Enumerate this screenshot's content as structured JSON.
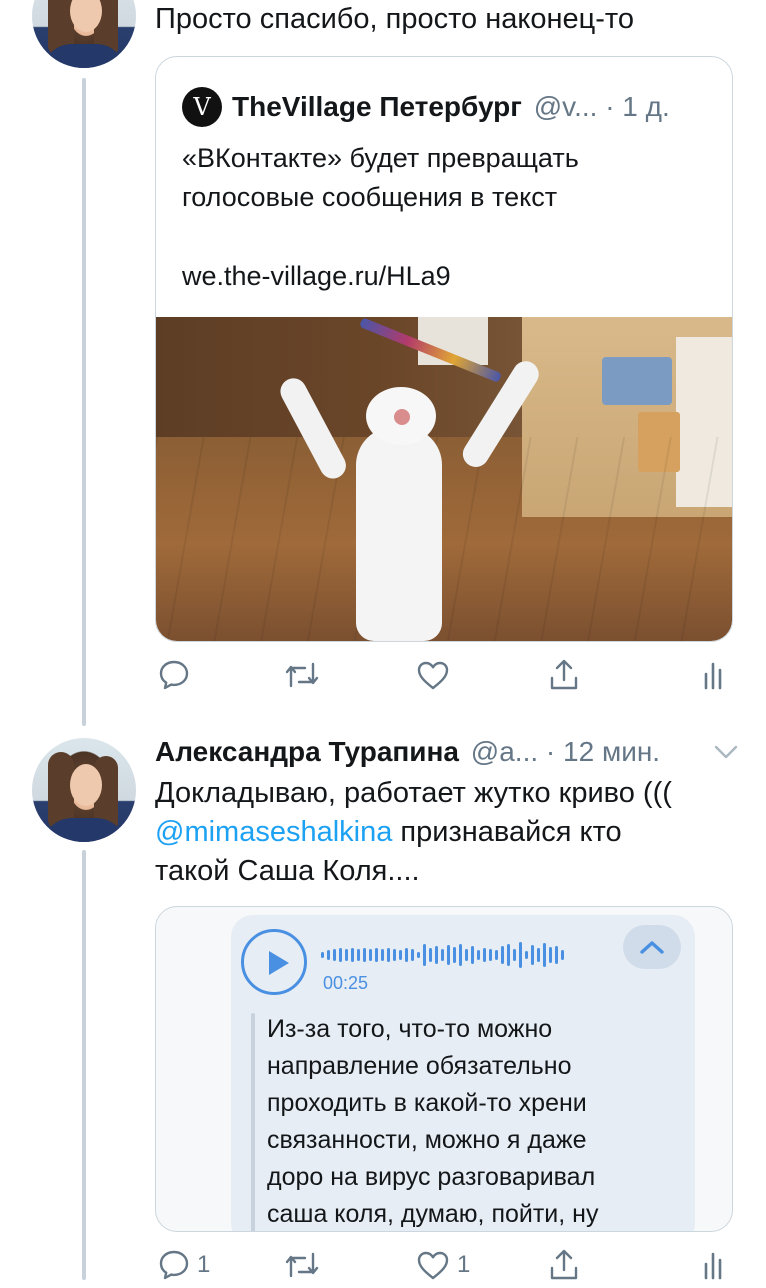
{
  "tweet1": {
    "text": "Просто спасибо, просто наконец-то",
    "quote": {
      "author_name": "TheVillage Петербург",
      "handle": "@v...",
      "separator": "·",
      "time": "1 д.",
      "logo_letter": "V",
      "text_line1": "«ВКонтакте» будет превращать",
      "text_line2": "голосовые сообщения в текст",
      "link": "we.the-village.ru/HLa9"
    },
    "actions": {
      "reply_count": "",
      "retweet_count": "",
      "like_count": ""
    }
  },
  "tweet2": {
    "author_name": "Александра Турапина",
    "handle": "@a...",
    "separator": "·",
    "time": "12 мин.",
    "text_line1": "Докладываю, работает жутко криво (((",
    "mention": "@mimaseshalkina",
    "text_line2_rest": " признавайся кто",
    "text_line3": "такой Саша Коля....",
    "voice": {
      "duration": "00:25",
      "transcript": [
        "Из-за того, что-то можно",
        "направление обязательно",
        "проходить в какой-то хрени",
        "связанности, можно я даже",
        "доро на вирус разговаривал",
        "саша коля, думаю, пойти, ну"
      ]
    },
    "actions": {
      "reply_count": "1",
      "retweet_count": "",
      "like_count": "1"
    }
  },
  "colors": {
    "link": "#1da1f2",
    "gray": "#657786",
    "voice_accent": "#4a90e2"
  }
}
